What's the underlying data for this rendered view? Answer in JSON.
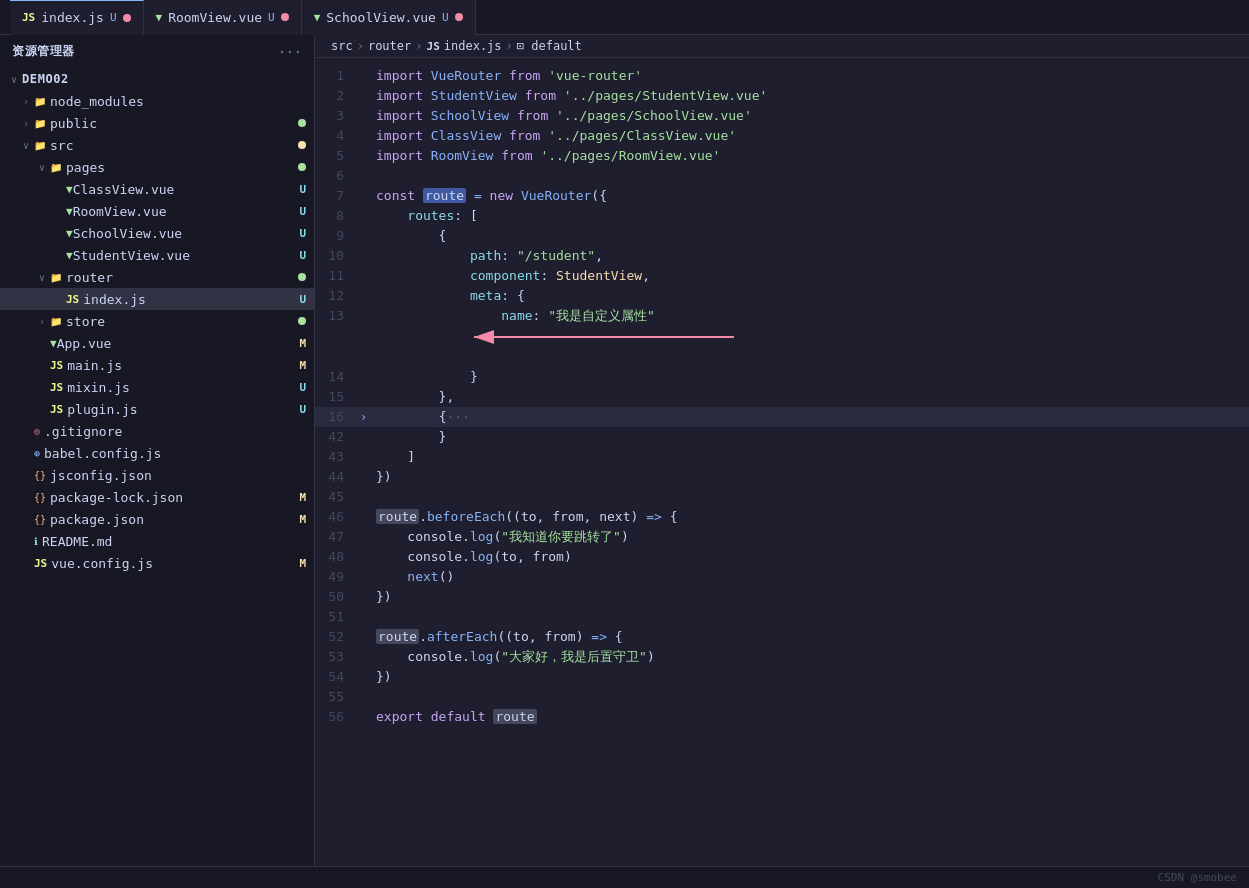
{
  "sidebar": {
    "header": "资源管理器",
    "dots_label": "···",
    "root": "DEMO02",
    "items": [
      {
        "id": "node_modules",
        "label": "node_modules",
        "type": "folder",
        "collapsed": true,
        "indent": 1,
        "badge": null
      },
      {
        "id": "public",
        "label": "public",
        "type": "folder",
        "collapsed": true,
        "indent": 1,
        "badge": null,
        "dot": "green"
      },
      {
        "id": "src",
        "label": "src",
        "type": "folder",
        "collapsed": false,
        "indent": 1,
        "badge": null,
        "dot": "yellow"
      },
      {
        "id": "pages",
        "label": "pages",
        "type": "folder",
        "collapsed": false,
        "indent": 2,
        "badge": null,
        "dot": "green"
      },
      {
        "id": "ClassView.vue",
        "label": "ClassView.vue",
        "type": "vue",
        "indent": 3,
        "badge": "U"
      },
      {
        "id": "RoomView.vue",
        "label": "RoomView.vue",
        "type": "vue",
        "indent": 3,
        "badge": "U"
      },
      {
        "id": "SchoolView.vue",
        "label": "SchoolView.vue",
        "type": "vue",
        "indent": 3,
        "badge": "U"
      },
      {
        "id": "StudentView.vue",
        "label": "StudentView.vue",
        "type": "vue",
        "indent": 3,
        "badge": "U"
      },
      {
        "id": "router",
        "label": "router",
        "type": "folder",
        "collapsed": false,
        "indent": 2,
        "badge": null,
        "dot": "green"
      },
      {
        "id": "index.js",
        "label": "index.js",
        "type": "js",
        "indent": 3,
        "badge": "U",
        "active": true
      },
      {
        "id": "store",
        "label": "store",
        "type": "folder",
        "collapsed": true,
        "indent": 2,
        "badge": null,
        "dot": "green"
      },
      {
        "id": "App.vue",
        "label": "App.vue",
        "type": "vue",
        "indent": 2,
        "badge": "M"
      },
      {
        "id": "main.js",
        "label": "main.js",
        "type": "js",
        "indent": 2,
        "badge": "M"
      },
      {
        "id": "mixin.js",
        "label": "mixin.js",
        "type": "js",
        "indent": 2,
        "badge": "U"
      },
      {
        "id": "plugin.js",
        "label": "plugin.js",
        "type": "js",
        "indent": 2,
        "badge": "U"
      },
      {
        "id": ".gitignore",
        "label": ".gitignore",
        "type": "git",
        "indent": 1,
        "badge": null
      },
      {
        "id": "babel.config.js",
        "label": "babel.config.js",
        "type": "js",
        "indent": 1,
        "badge": null
      },
      {
        "id": "jsconfig.json",
        "label": "jsconfig.json",
        "type": "json",
        "indent": 1,
        "badge": null
      },
      {
        "id": "package-lock.json",
        "label": "package-lock.json",
        "type": "json",
        "indent": 1,
        "badge": "M"
      },
      {
        "id": "package.json",
        "label": "package.json",
        "type": "json",
        "indent": 1,
        "badge": "M"
      },
      {
        "id": "README.md",
        "label": "README.md",
        "type": "md",
        "indent": 1,
        "badge": null
      },
      {
        "id": "vue.config.js",
        "label": "vue.config.js",
        "type": "js",
        "indent": 1,
        "badge": "M"
      }
    ]
  },
  "tabs": [
    {
      "label": "index.js",
      "type": "js",
      "unsaved": true,
      "active": true
    },
    {
      "label": "RoomView.vue",
      "type": "vue",
      "unsaved": true,
      "active": false
    },
    {
      "label": "SchoolView.vue",
      "type": "vue",
      "unsaved": true,
      "active": false
    }
  ],
  "breadcrumb": {
    "parts": [
      "src",
      ">",
      "router",
      ">",
      "JS index.js",
      ">",
      "⊡ default"
    ]
  },
  "lines": [
    {
      "num": 1,
      "content": "import_kw VueRouter_fn from_kw 'vue-router'_str"
    },
    {
      "num": 2,
      "content": "import_kw StudentView_fn from_kw '../pages/StudentView.vue'_str"
    },
    {
      "num": 3,
      "content": "import_kw SchoolView_fn from_kw '../pages/SchoolView.vue'_str"
    },
    {
      "num": 4,
      "content": "import_kw ClassView_fn from_kw '../pages/ClassView.vue'_str"
    },
    {
      "num": 5,
      "content": "import_kw RoomView_fn from_kw '../pages/RoomView.vue'_str"
    },
    {
      "num": 6,
      "content": ""
    },
    {
      "num": 7,
      "content": "const_kw route_hl = new_kw VueRouter_fn({"
    },
    {
      "num": 8,
      "content": "    routes: ["
    },
    {
      "num": 9,
      "content": "        {"
    },
    {
      "num": 10,
      "content": "            path: \"/student\","
    },
    {
      "num": 11,
      "content": "            component: StudentView,"
    },
    {
      "num": 12,
      "content": "            meta: {"
    },
    {
      "num": 13,
      "content": "                name: \"我是自定义属性\""
    },
    {
      "num": 14,
      "content": "            }"
    },
    {
      "num": 15,
      "content": "        },"
    },
    {
      "num": 16,
      "content": "        {···",
      "arrow": true,
      "active": true
    },
    {
      "num": 42,
      "content": "        }"
    },
    {
      "num": 43,
      "content": "    ]"
    },
    {
      "num": 44,
      "content": "})"
    },
    {
      "num": 45,
      "content": ""
    },
    {
      "num": 46,
      "content": "route_hl2.beforeEach((to, from, next) => {"
    },
    {
      "num": 47,
      "content": "    console.log(\"我知道你要跳转了\")"
    },
    {
      "num": 48,
      "content": "    console.log(to, from)"
    },
    {
      "num": 49,
      "content": "    next()"
    },
    {
      "num": 50,
      "content": "})"
    },
    {
      "num": 51,
      "content": ""
    },
    {
      "num": 52,
      "content": "route_hl2.afterEach((to, from) => {"
    },
    {
      "num": 53,
      "content": "    console.log(\"大家好，我是后置守卫\")"
    },
    {
      "num": 54,
      "content": "})"
    },
    {
      "num": 55,
      "content": ""
    },
    {
      "num": 56,
      "content": "export default route_hl2"
    }
  ],
  "watermark": "CSDN @smobee"
}
